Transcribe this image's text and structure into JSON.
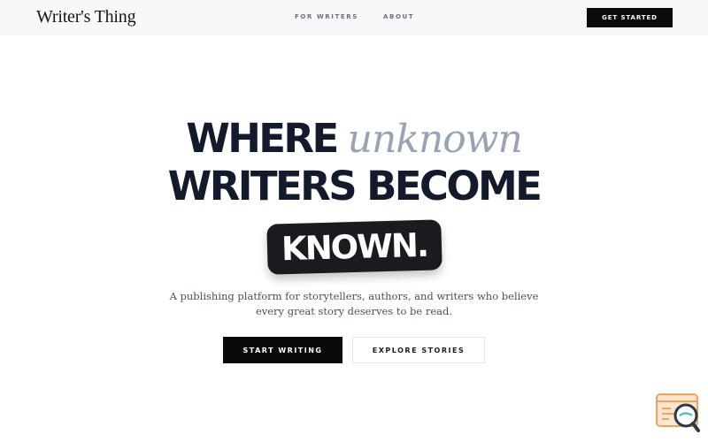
{
  "header": {
    "logo_text": "Writer's Thing",
    "nav": [
      {
        "label": "FOR WRITERS"
      },
      {
        "label": "ABOUT"
      }
    ],
    "cta_label": "GET STARTED"
  },
  "hero": {
    "line1_bold": "WHERE",
    "line1_italic": "unknown",
    "line2": "WRITERS BECOME",
    "highlight": "KNOWN.",
    "subtitle_line1": "A publishing platform for storytellers, authors, and writers who believe",
    "subtitle_line2": "every great story deserves to be read.",
    "primary_button": "START WRITING",
    "secondary_button": "EXPLORE STORIES"
  },
  "widget": {
    "icon": "document-search-icon",
    "colors": {
      "orange": "#f0a35e",
      "dark": "#2f3a45",
      "teal": "#5fb8c8"
    }
  },
  "colors": {
    "headline": "#131a2c",
    "italic_accent": "#9aa3b4",
    "button_dark": "#0a0a0c",
    "header_bg": "#f8f8fa"
  }
}
